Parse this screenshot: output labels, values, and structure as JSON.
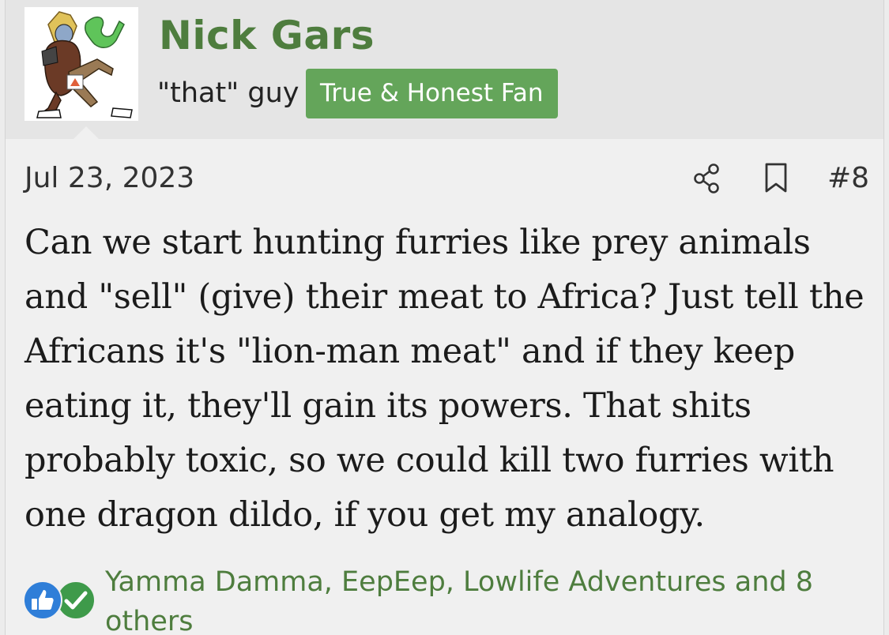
{
  "post": {
    "author": {
      "name": "Nick Gars",
      "title": "\"that\" guy",
      "banner": "True & Honest Fan",
      "colors": {
        "name": "#4e7d3e",
        "banner_bg": "#64a55a"
      }
    },
    "date": "Jul 23, 2023",
    "number": "#8",
    "actions": [
      "share-icon",
      "bookmark-icon"
    ],
    "body": "Can we start hunting furries like prey animals and \"sell\" (give) their meat to Africa? Just tell the Africans it's \"lion-man meat\" and if they keep eating it, they'll gain its powers. That shits probably toxic, so we could kill two furries with one dragon dildo, if you get my analogy.",
    "reactions": {
      "icons": [
        "like-icon",
        "agree-icon"
      ],
      "users": "Yamma Damma, EepEep, Lowlife Adventures and 8 others"
    }
  }
}
